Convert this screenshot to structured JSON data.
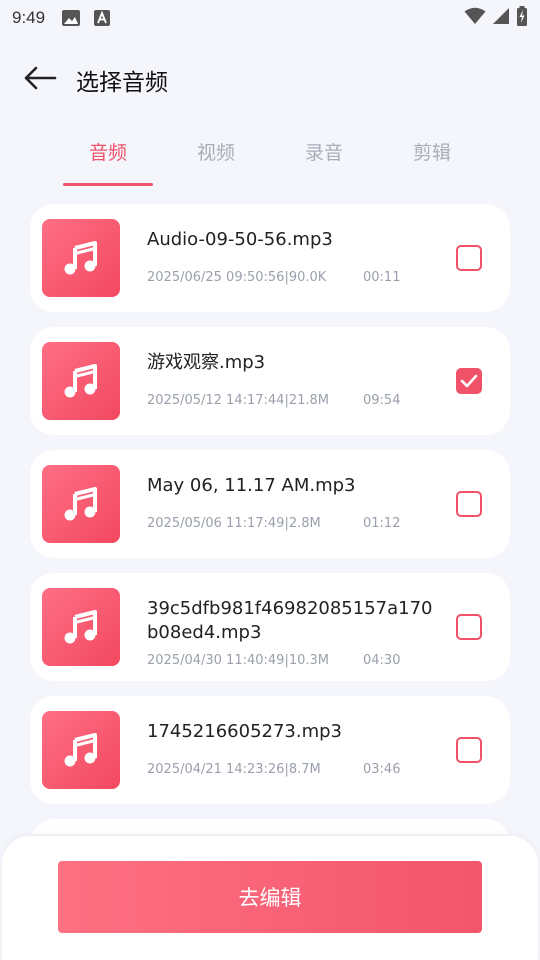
{
  "status_bar": {
    "time": "9:49",
    "icons_left": [
      "image-icon",
      "text-a-icon"
    ],
    "icons_right": [
      "wifi-icon",
      "signal-icon",
      "battery-charging-icon"
    ]
  },
  "header": {
    "back_icon": "arrow-left-icon",
    "title": "选择音频"
  },
  "tabs": [
    {
      "label": "音频",
      "active": true
    },
    {
      "label": "视频",
      "active": false
    },
    {
      "label": "录音",
      "active": false
    },
    {
      "label": "剪辑",
      "active": false
    }
  ],
  "files": [
    {
      "name": "Audio-09-50-56.mp3",
      "meta": "2025/06/25 09:50:56|90.0K",
      "duration": "00:11",
      "checked": false
    },
    {
      "name": "游戏观察.mp3",
      "meta": "2025/05/12 14:17:44|21.8M",
      "duration": "09:54",
      "checked": true
    },
    {
      "name": "May 06, 11.17 AM.mp3",
      "meta": "2025/05/06 11:17:49|2.8M",
      "duration": "01:12",
      "checked": false
    },
    {
      "name": "39c5dfb981f46982085157a170b08ed4.mp3",
      "meta": "2025/04/30 11:40:49|10.3M",
      "duration": "04:30",
      "checked": false
    },
    {
      "name": "1745216605273.mp3",
      "meta": "2025/04/21 14:23:26|8.7M",
      "duration": "03:46",
      "checked": false
    }
  ],
  "footer": {
    "edit_label": "去编辑"
  },
  "colors": {
    "accent": "#f0526a",
    "background": "#f4f6fc",
    "inactive_tab": "#a9adb8"
  }
}
